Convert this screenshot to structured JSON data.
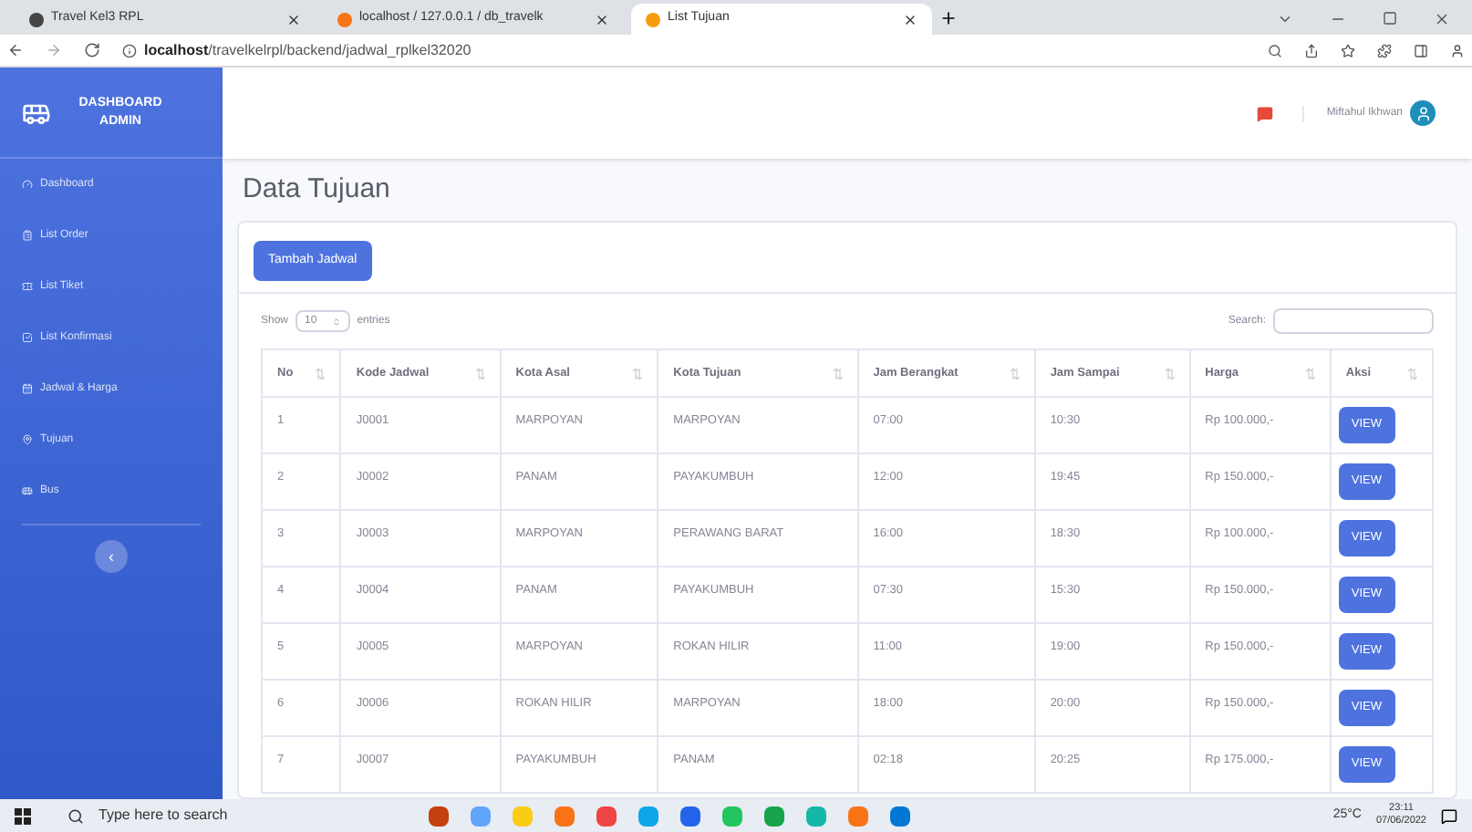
{
  "browser": {
    "tabs": [
      {
        "title": "Travel Kel3 RPL",
        "selected": false
      },
      {
        "title": "localhost / 127.0.0.1 / db_travelk",
        "selected": false
      },
      {
        "title": "List Tujuan",
        "selected": true
      }
    ],
    "url_host": "localhost",
    "url_path": "/travelkelrpl/backend/jadwal_rplkel32020"
  },
  "sidebar": {
    "brand": "DASHBOARD ADMIN",
    "items": [
      "Dashboard",
      "List Order",
      "List Tiket",
      "List Konfirmasi",
      "Jadwal & Harga",
      "Tujuan",
      "Bus"
    ],
    "collapse_button": "‹"
  },
  "topbar": {
    "user": "Miftahul Ikhwan"
  },
  "page_title": "Data Tujuan",
  "add_button": "Tambah Jadwal",
  "table_controls": {
    "show_label": "Show",
    "entries_value": "10",
    "entries_label": "entries",
    "search_label": "Search:"
  },
  "table": {
    "columns": [
      "No",
      "Kode Jadwal",
      "Kota Asal",
      "Kota Tujuan",
      "Jam Berangkat",
      "Jam Sampai",
      "Harga",
      "Aksi"
    ],
    "rows": [
      {
        "cells": [
          "1",
          "J0001",
          "MARPOYAN",
          "MARPOYAN",
          "07:00",
          "10:30",
          "Rp 100.000,-"
        ],
        "action": "VIEW"
      },
      {
        "cells": [
          "2",
          "J0002",
          "PANAM",
          "PAYAKUMBUH",
          "12:00",
          "19:45",
          "Rp 150.000,-"
        ],
        "action": "VIEW"
      },
      {
        "cells": [
          "3",
          "J0003",
          "MARPOYAN",
          "PERAWANG BARAT",
          "16:00",
          "18:30",
          "Rp 100.000,-"
        ],
        "action": "VIEW"
      },
      {
        "cells": [
          "4",
          "J0004",
          "PANAM",
          "PAYAKUMBUH",
          "07:30",
          "15:30",
          "Rp 150.000,-"
        ],
        "action": "VIEW"
      },
      {
        "cells": [
          "5",
          "J0005",
          "MARPOYAN",
          "ROKAN HILIR",
          "11:00",
          "19:00",
          "Rp 150.000,-"
        ],
        "action": "VIEW"
      },
      {
        "cells": [
          "6",
          "J0006",
          "ROKAN HILIR",
          "MARPOYAN",
          "18:00",
          "20:00",
          "Rp 150.000,-"
        ],
        "action": "VIEW"
      },
      {
        "cells": [
          "7",
          "J0007",
          "PAYAKUMBUH",
          "PANAM",
          "02:18",
          "20:25",
          "Rp 175.000,-"
        ],
        "action": "VIEW"
      }
    ]
  },
  "taskbar": {
    "search_placeholder": "Type here to search",
    "weather": "25°C",
    "time": "23:11",
    "date": "07/06/2022"
  }
}
